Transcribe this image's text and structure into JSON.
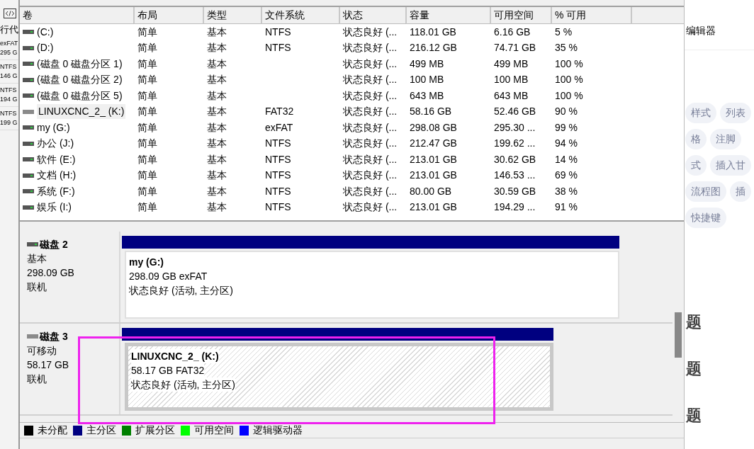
{
  "background_left": {
    "heading": "行代",
    "items": [
      {
        "fs": "exFAT",
        "size": "295 G"
      },
      {
        "fs": "NTFS",
        "size": "146 G"
      },
      {
        "fs": "NTFS",
        "size": "194 G"
      },
      {
        "fs": "NTFS",
        "size": "199 G"
      }
    ]
  },
  "table": {
    "columns": [
      "卷",
      "布局",
      "类型",
      "文件系统",
      "状态",
      "容量",
      "可用空间",
      "% 可用"
    ],
    "rows": [
      {
        "selected": false,
        "cells": [
          " (C:)",
          "简单",
          "基本",
          "NTFS",
          "状态良好 (...",
          "118.01 GB",
          "6.16 GB",
          "5 %"
        ]
      },
      {
        "selected": false,
        "cells": [
          " (D:)",
          "简单",
          "基本",
          "NTFS",
          "状态良好 (...",
          "216.12 GB",
          "74.71 GB",
          "35 %"
        ]
      },
      {
        "selected": false,
        "cells": [
          "(磁盘 0 磁盘分区 1)",
          "简单",
          "基本",
          "",
          "状态良好 (...",
          "499 MB",
          "499 MB",
          "100 %"
        ]
      },
      {
        "selected": false,
        "cells": [
          "(磁盘 0 磁盘分区 2)",
          "简单",
          "基本",
          "",
          "状态良好 (...",
          "100 MB",
          "100 MB",
          "100 %"
        ]
      },
      {
        "selected": false,
        "cells": [
          "(磁盘 0 磁盘分区 5)",
          "简单",
          "基本",
          "",
          "状态良好 (...",
          "643 MB",
          "643 MB",
          "100 %"
        ]
      },
      {
        "selected": true,
        "cells": [
          "LINUXCNC_2_ (K:)",
          "简单",
          "基本",
          "FAT32",
          "状态良好 (...",
          "58.16 GB",
          "52.46 GB",
          "90 %"
        ]
      },
      {
        "selected": false,
        "cells": [
          "my (G:)",
          "简单",
          "基本",
          "exFAT",
          "状态良好 (...",
          "298.08 GB",
          "295.30 ...",
          "99 %"
        ]
      },
      {
        "selected": false,
        "cells": [
          "办公 (J:)",
          "简单",
          "基本",
          "NTFS",
          "状态良好 (...",
          "212.47 GB",
          "199.62 ...",
          "94 %"
        ]
      },
      {
        "selected": false,
        "cells": [
          "软件 (E:)",
          "简单",
          "基本",
          "NTFS",
          "状态良好 (...",
          "213.01 GB",
          "30.62 GB",
          "14 %"
        ]
      },
      {
        "selected": false,
        "cells": [
          "文档 (H:)",
          "简单",
          "基本",
          "NTFS",
          "状态良好 (...",
          "213.01 GB",
          "146.53 ...",
          "69 %"
        ]
      },
      {
        "selected": false,
        "cells": [
          "系统 (F:)",
          "简单",
          "基本",
          "NTFS",
          "状态良好 (...",
          "80.00 GB",
          "30.59 GB",
          "38 %"
        ]
      },
      {
        "selected": false,
        "cells": [
          "娱乐 (I:)",
          "简单",
          "基本",
          "NTFS",
          "状态良好 (...",
          "213.01 GB",
          "194.29 ...",
          "91 %"
        ]
      }
    ]
  },
  "disks": [
    {
      "name": "磁盘 2",
      "type": "基本",
      "size": "298.09 GB",
      "status": "联机",
      "removable": false,
      "partition": {
        "title": "my  (G:)",
        "info": "298.09 GB exFAT",
        "state": "状态良好 (活动, 主分区)",
        "selected": false
      }
    },
    {
      "name": "磁盘 3",
      "type": "可移动",
      "size": "58.17 GB",
      "status": "联机",
      "removable": true,
      "partition": {
        "title": "LINUXCNC_2_  (K:)",
        "info": "58.17 GB FAT32",
        "state": "状态良好 (活动, 主分区)",
        "selected": true
      }
    }
  ],
  "legend": [
    {
      "label": "未分配",
      "color": "#000000"
    },
    {
      "label": "主分区",
      "color": "#000080"
    },
    {
      "label": "扩展分区",
      "color": "#008000"
    },
    {
      "label": "可用空间",
      "color": "#00ff00"
    },
    {
      "label": "逻辑驱动器",
      "color": "#0000ff"
    }
  ],
  "background_right": {
    "title": "编辑器",
    "chip_rows": [
      [
        "样式",
        "列表"
      ],
      [
        "格",
        "注脚"
      ],
      [
        "式",
        "插入甘"
      ],
      [
        "流程图",
        "插"
      ],
      [
        "快捷键"
      ]
    ],
    "headings": [
      "题",
      "题",
      "题"
    ]
  }
}
